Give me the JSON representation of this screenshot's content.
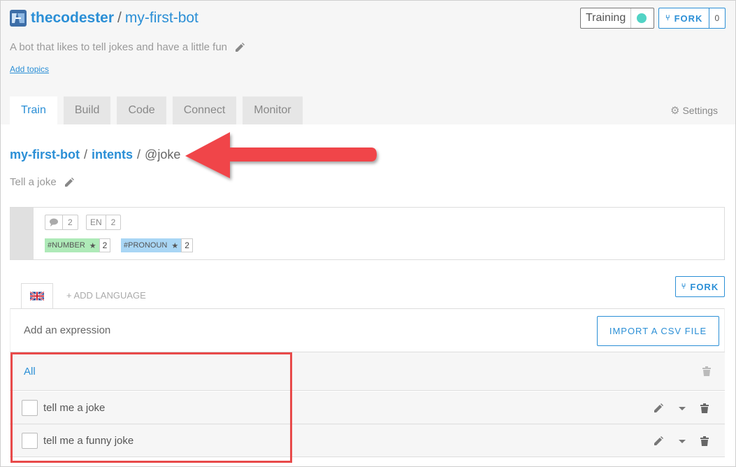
{
  "repo": {
    "owner": "thecodester",
    "separator": "/",
    "name": "my-first-bot",
    "description": "A bot that likes to tell jokes and have a little fun",
    "add_topics": "Add topics"
  },
  "header_actions": {
    "training_label": "Training",
    "training_status_color": "#52d3c5",
    "fork_label": "FORK",
    "fork_count": "0"
  },
  "tabs": [
    {
      "label": "Train",
      "active": true
    },
    {
      "label": "Build"
    },
    {
      "label": "Code"
    },
    {
      "label": "Connect"
    },
    {
      "label": "Monitor"
    }
  ],
  "settings_label": "Settings",
  "breadcrumb": {
    "bot": "my-first-bot",
    "sep": "/",
    "intents": "intents",
    "current": "@joke"
  },
  "intent_description": "Tell a joke",
  "meta": {
    "expressions_count": "2",
    "lang_code": "EN",
    "lang_count": "2",
    "entities": [
      {
        "name": "#NUMBER",
        "star": "★",
        "count": "2",
        "color": "#aeeab8"
      },
      {
        "name": "#PRONOUN",
        "star": "★",
        "count": "2",
        "color": "#a9d6f5"
      }
    ]
  },
  "language": {
    "flag": "uk-flag-icon",
    "add_language": "+ ADD LANGUAGE",
    "fork_label": "FORK"
  },
  "expression": {
    "placeholder": "Add an expression",
    "import_label": "IMPORT A CSV FILE"
  },
  "list": {
    "filter_label": "All",
    "items": [
      {
        "text": "tell me a joke"
      },
      {
        "text": "tell me a funny joke"
      }
    ]
  },
  "annotation_color": "#e84a4a"
}
